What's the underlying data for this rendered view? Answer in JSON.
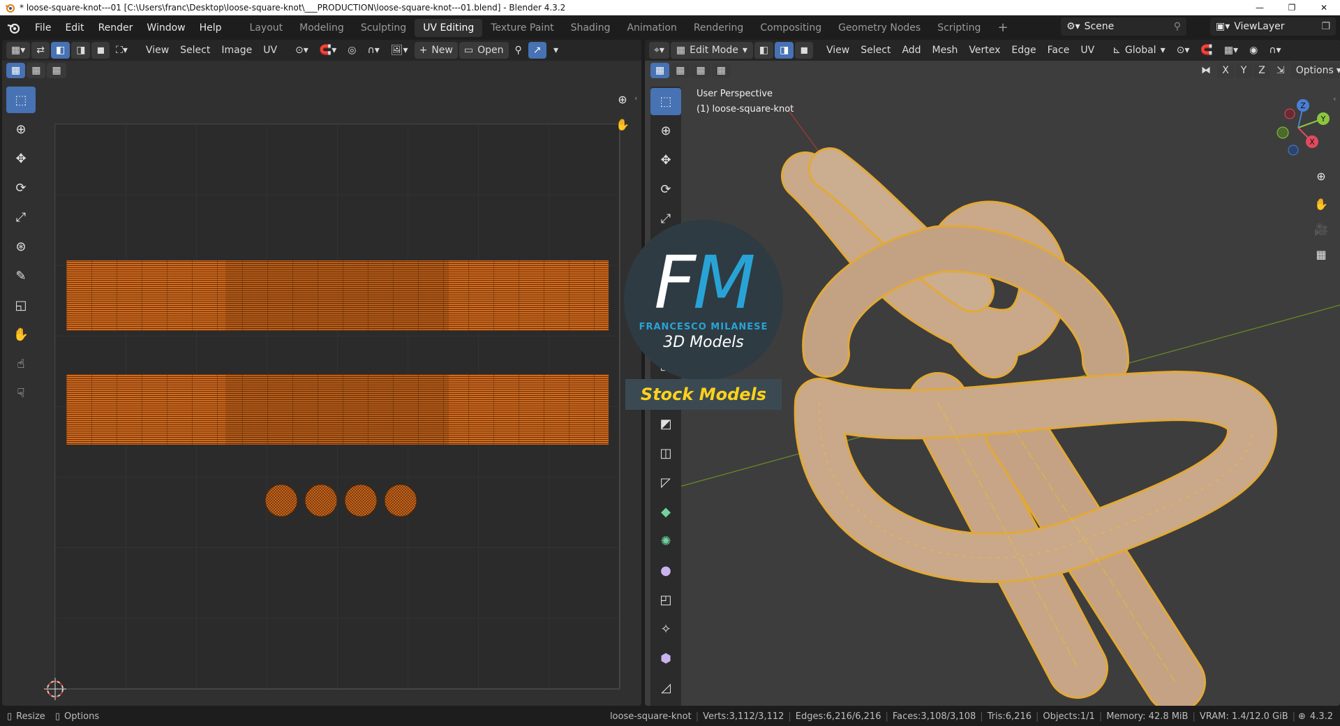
{
  "window": {
    "title": "* loose-square-knot---01 [C:\\Users\\franc\\Desktop\\loose-square-knot\\___PRODUCTION\\loose-square-knot---01.blend] - Blender 4.3.2",
    "minimize": "—",
    "maximize": "❐",
    "close": "✕"
  },
  "menus": [
    "File",
    "Edit",
    "Render",
    "Window",
    "Help"
  ],
  "workspaces": [
    "Layout",
    "Modeling",
    "Sculpting",
    "UV Editing",
    "Texture Paint",
    "Shading",
    "Animation",
    "Rendering",
    "Compositing",
    "Geometry Nodes",
    "Scripting"
  ],
  "active_workspace": "UV Editing",
  "add_workspace": "+",
  "scene": {
    "label": "Scene",
    "view_layer": "ViewLayer"
  },
  "uv_editor": {
    "header_menus": [
      "View",
      "Select",
      "Image",
      "UV"
    ],
    "new_label": "New",
    "open_label": "Open",
    "plus": "+"
  },
  "viewport": {
    "mode": "Edit Mode",
    "header_menus": [
      "View",
      "Select",
      "Add",
      "Mesh",
      "Vertex",
      "Edge",
      "Face",
      "UV"
    ],
    "orientation": "Global",
    "options_label": "Options",
    "axes": [
      "X",
      "Y",
      "Z"
    ],
    "perspective_label": "User Perspective",
    "object_label": "(1) loose-square-knot",
    "gizmo": {
      "z": "Z",
      "y": "Y",
      "x": "X"
    }
  },
  "logo": {
    "initials_f": "F",
    "initials_m": "M",
    "name": "FRANCESCO MILANESE",
    "subtitle": "3D Models",
    "stock": "Stock Models"
  },
  "status": {
    "resize": "Resize",
    "options": "Options",
    "object": "loose-square-knot",
    "verts": "Verts:3,112/3,112",
    "edges": "Edges:6,216/6,216",
    "faces": "Faces:3,108/3,108",
    "tris": "Tris:6,216",
    "objects": "Objects:1/1",
    "memory": "Memory: 42.8 MiB",
    "vram": "VRAM: 1.4/12.0 GiB",
    "version": "4.3.2"
  },
  "colors": {
    "accent": "#4772b3",
    "uv_orange": "#d2691e",
    "mesh_wire": "#f5c518",
    "mesh_fill": "#c9a98a",
    "logo_blue": "#29a3d6",
    "logo_yellow": "#ffd21a"
  }
}
